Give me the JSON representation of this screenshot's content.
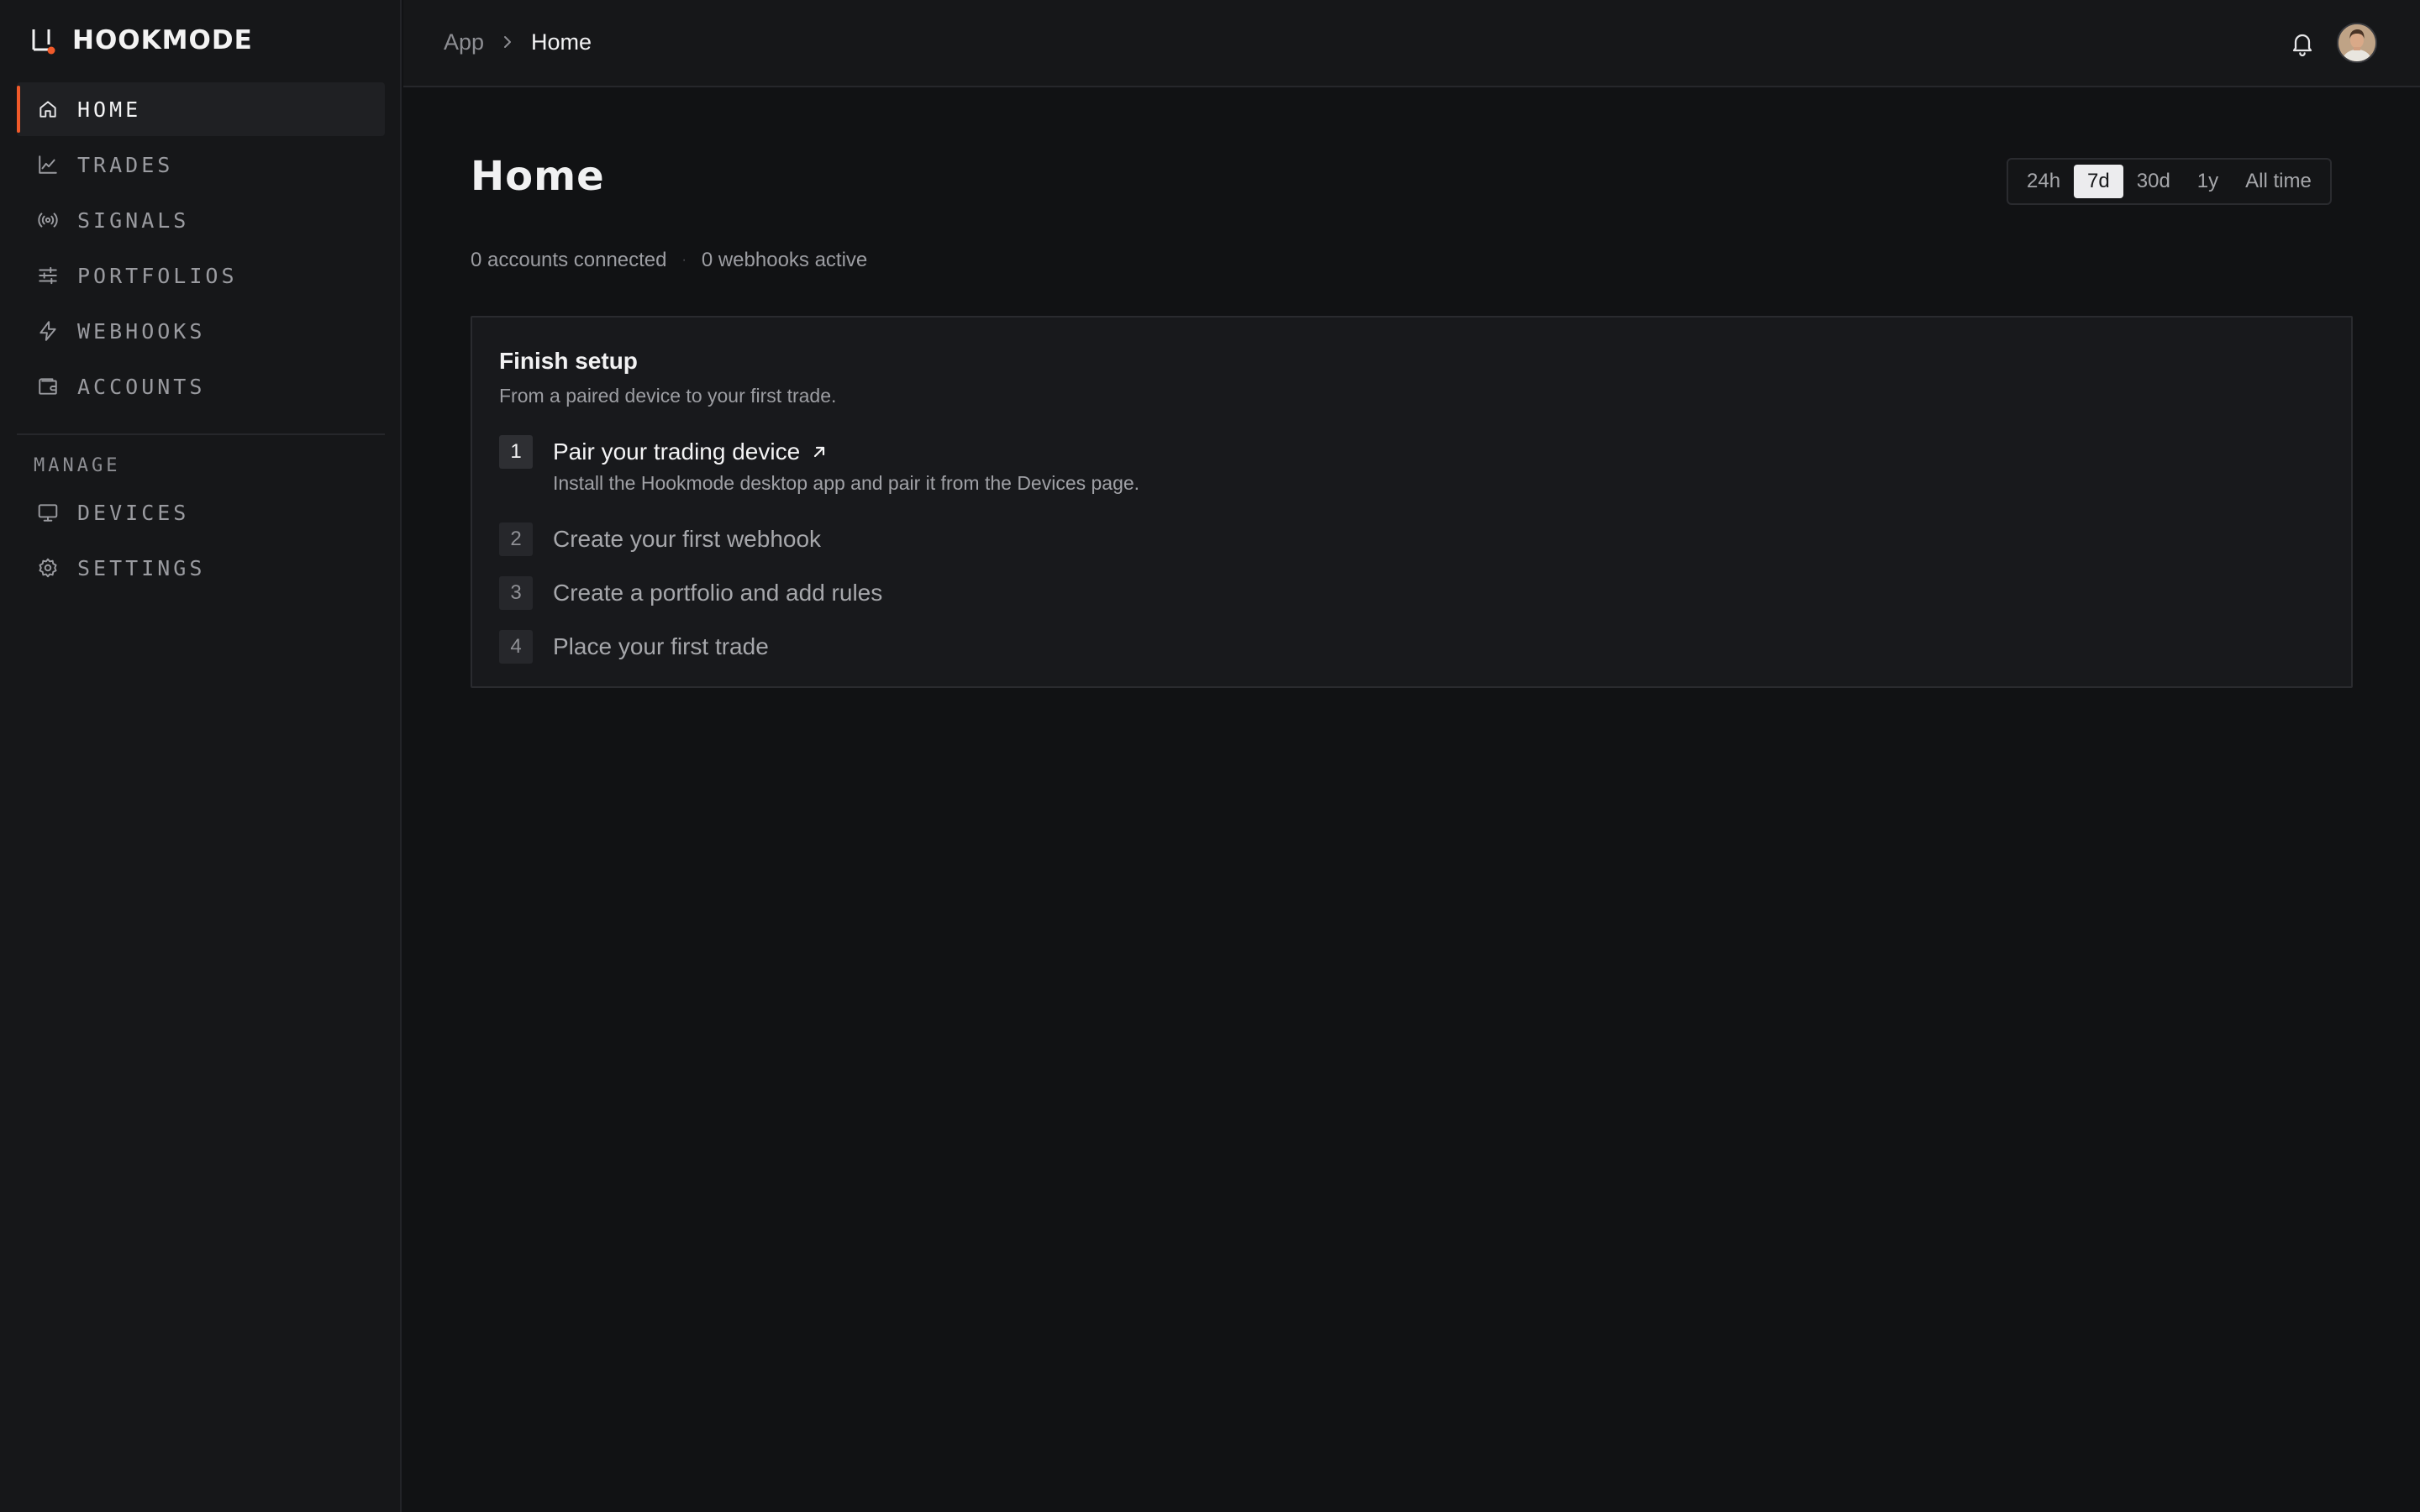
{
  "brand": {
    "name": "HOOKMODE",
    "accent": "#f05a2a"
  },
  "sidebar": {
    "main_items": [
      {
        "label": "HOME",
        "icon": "home-icon",
        "active": true
      },
      {
        "label": "TRADES",
        "icon": "chart-line-icon"
      },
      {
        "label": "SIGNALS",
        "icon": "broadcast-icon"
      },
      {
        "label": "PORTFOLIOS",
        "icon": "sliders-icon"
      },
      {
        "label": "WEBHOOKS",
        "icon": "lightning-icon"
      },
      {
        "label": "ACCOUNTS",
        "icon": "wallet-icon"
      }
    ],
    "section_label": "MANAGE",
    "manage_items": [
      {
        "label": "DEVICES",
        "icon": "monitor-icon"
      },
      {
        "label": "SETTINGS",
        "icon": "gear-icon"
      }
    ]
  },
  "topbar": {
    "breadcrumb": {
      "parent": "App",
      "current": "Home"
    },
    "notifications_icon": "bell-icon",
    "avatar_icon": "user-avatar"
  },
  "main": {
    "title": "Home",
    "ranges": [
      "24h",
      "7d",
      "30d",
      "1y",
      "All time"
    ],
    "selected_range": "7d",
    "stats": {
      "accounts": "0 accounts connected",
      "separator": "·",
      "webhooks": "0 webhooks active"
    },
    "setup": {
      "title": "Finish setup",
      "subtitle": "From a paired device to your first trade.",
      "steps": [
        {
          "number": "1",
          "title": "Pair your trading device",
          "description": "Install the Hookmode desktop app and pair it from the Devices page.",
          "current": true
        },
        {
          "number": "2",
          "title": "Create your first webhook"
        },
        {
          "number": "3",
          "title": "Create a portfolio and add rules"
        },
        {
          "number": "4",
          "title": "Place your first trade"
        }
      ]
    }
  }
}
